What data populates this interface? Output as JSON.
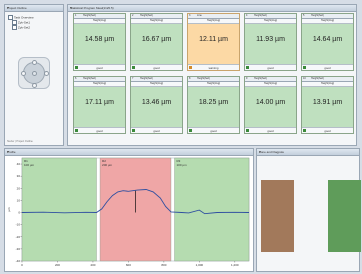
{
  "explorer": {
    "title": "Project Outline",
    "items": [
      "Task Overview",
      "Zyk-Set1",
      "Zyk-Set2"
    ],
    "footer": "Sterler | Project Outline"
  },
  "grid": {
    "title": "Statistical Program Meal(1/4/0.5)",
    "cells": [
      {
        "idx": "1",
        "name": "Height(fwd)",
        "type": "Height(Avg)",
        "value": "14.58 µm",
        "status": "good",
        "level": "ok"
      },
      {
        "idx": "2",
        "name": "Height(fwd)",
        "type": "Height(Avg)",
        "value": "16.67 µm",
        "status": "good",
        "level": "ok"
      },
      {
        "idx": "3",
        "name": "Line",
        "type": "Height(Avg)",
        "value": "12.11 µm",
        "status": "warning",
        "level": "warn"
      },
      {
        "idx": "4",
        "name": "Height(fwd)",
        "type": "Height(Avg)",
        "value": "11.93 µm",
        "status": "good",
        "level": "ok"
      },
      {
        "idx": "5",
        "name": "Height(fwd)",
        "type": "Height(Avg)",
        "value": "14.64 µm",
        "status": "good",
        "level": "ok"
      },
      {
        "idx": "6",
        "name": "Height(fwd)",
        "type": "Height(Avg)",
        "value": "17.11 µm",
        "status": "good",
        "level": "ok"
      },
      {
        "idx": "7",
        "name": "Height(fwd)",
        "type": "Height(Avg)",
        "value": "13.46 µm",
        "status": "good",
        "level": "ok"
      },
      {
        "idx": "8",
        "name": "Height(fwd)",
        "type": "Height(Avg)",
        "value": "18.25 µm",
        "status": "good",
        "level": "ok"
      },
      {
        "idx": "9",
        "name": "Height(fwd)",
        "type": "Height(Avg)",
        "value": "14.00 µm",
        "status": "good",
        "level": "ok"
      },
      {
        "idx": "10",
        "name": "Height(fwd)",
        "type": "Height(Avg)",
        "value": "13.91 µm",
        "status": "good",
        "level": "ok"
      }
    ]
  },
  "plot": {
    "title": "Profile",
    "ylabel": "µm",
    "yticks": [
      "40",
      "30",
      "20",
      "10",
      "0",
      "-10",
      "-20",
      "-30",
      "-40"
    ],
    "xticks": [
      "0",
      "200",
      "400",
      "600",
      "800",
      "1,000",
      "1,200"
    ],
    "ymin": -40,
    "ymax": 45,
    "xmin": 0,
    "xmax": 1280,
    "regions": [
      {
        "from": 0,
        "to": 420,
        "color": "#b5dcb0",
        "tag": "R1",
        "sub": "100 µm"
      },
      {
        "from": 440,
        "to": 840,
        "color": "#efa6a6",
        "tag": "R2",
        "sub": "200 µm"
      },
      {
        "from": 860,
        "to": 1280,
        "color": "#b5dcb0",
        "tag": "R3",
        "sub": "100 µm"
      }
    ],
    "profile": [
      [
        0,
        0
      ],
      [
        120,
        0.3
      ],
      [
        240,
        -0.2
      ],
      [
        360,
        0.2
      ],
      [
        420,
        0
      ],
      [
        450,
        3
      ],
      [
        480,
        9
      ],
      [
        510,
        14
      ],
      [
        540,
        17
      ],
      [
        570,
        18
      ],
      [
        600,
        17.5
      ],
      [
        650,
        18.5
      ],
      [
        700,
        19
      ],
      [
        740,
        17
      ],
      [
        780,
        12
      ],
      [
        810,
        5
      ],
      [
        840,
        0.5
      ],
      [
        900,
        0
      ],
      [
        940,
        -0.3
      ],
      [
        1000,
        2
      ],
      [
        1030,
        -1
      ],
      [
        1100,
        0
      ],
      [
        1200,
        0.2
      ],
      [
        1280,
        0
      ]
    ],
    "marker_x": 640,
    "marker_ylow": 0,
    "marker_yhigh": 18
  },
  "overview": {
    "title": "Zone and Flagpole",
    "colors": {
      "left": "#a2795b",
      "right": "#5f9c5a"
    }
  }
}
